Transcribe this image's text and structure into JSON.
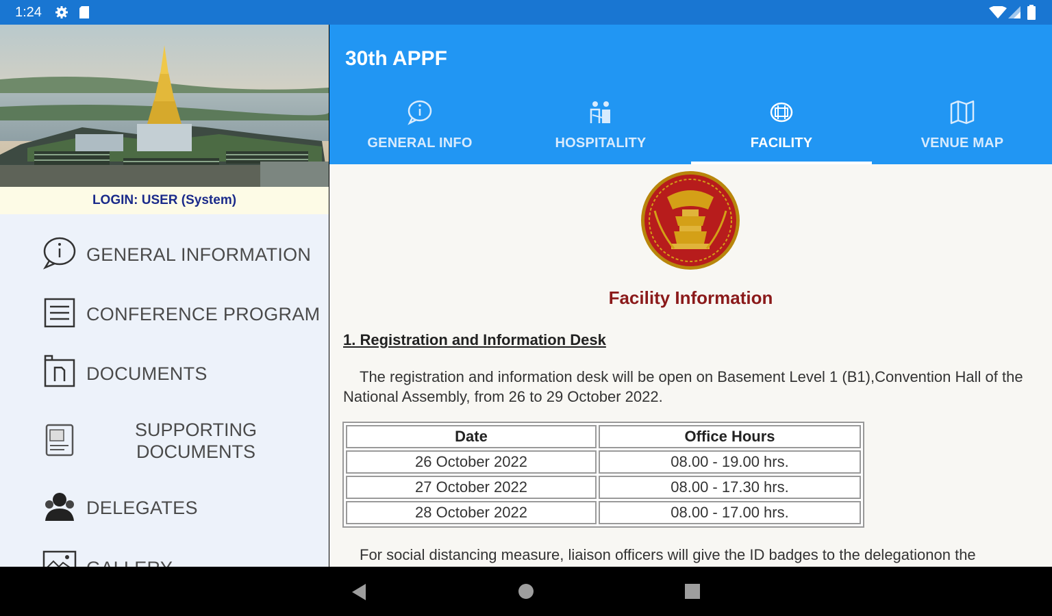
{
  "status": {
    "time": "1:24"
  },
  "drawer": {
    "login_text": "LOGIN: USER (System)",
    "items": [
      {
        "label": "GENERAL INFORMATION",
        "icon": "info-bubble-icon"
      },
      {
        "label": "CONFERENCE PROGRAM",
        "icon": "list-icon"
      },
      {
        "label": "DOCUMENTS",
        "icon": "documents-icon"
      },
      {
        "label": "SUPPORTING DOCUMENTS",
        "icon": "supporting-documents-icon"
      },
      {
        "label": "DELEGATES",
        "icon": "delegates-icon"
      },
      {
        "label": "GALLERY",
        "icon": "gallery-icon"
      }
    ]
  },
  "appbar": {
    "title": "30th APPF",
    "tabs": [
      {
        "label": "GENERAL INFO",
        "icon": "info-icon"
      },
      {
        "label": "HOSPITALITY",
        "icon": "hospitality-icon"
      },
      {
        "label": "FACILITY",
        "icon": "facility-icon",
        "active": true
      },
      {
        "label": "VENUE MAP",
        "icon": "map-icon"
      }
    ]
  },
  "content": {
    "title": "Facility Information",
    "section1_heading": "1. Registration and Information Desk",
    "section1_text": "The registration and information desk will be open on Basement Level 1 (B1),Convention Hall of the National Assembly, from 26 to 29 October 2022.",
    "table": {
      "headers": [
        "Date",
        "Office Hours"
      ],
      "rows": [
        [
          "26 October 2022",
          "08.00 - 19.00 hrs."
        ],
        [
          "27 October 2022",
          "08.00 - 17.30 hrs."
        ],
        [
          "28 October 2022",
          "08.00 - 17.00 hrs."
        ]
      ]
    },
    "section1_text2": "For social distancing measure, liaison officers will give the ID badges to the delegationon the"
  },
  "colors": {
    "status_bar": "#1976d2",
    "app_bar": "#2196f3",
    "title_red": "#8b1a1a",
    "login_text": "#1a2a8a"
  }
}
